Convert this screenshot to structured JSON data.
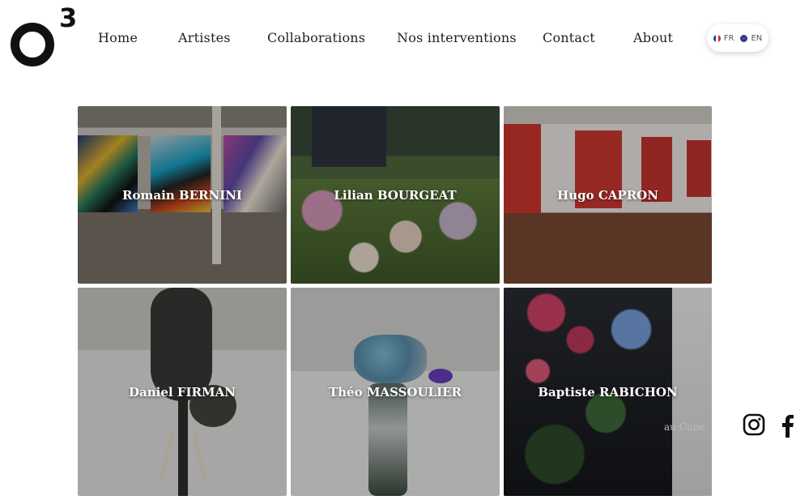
{
  "logo": {
    "letter": "O",
    "superscript": "3"
  },
  "nav": {
    "items": [
      {
        "label": "Home"
      },
      {
        "label": "Artistes"
      },
      {
        "label": "Collaborations"
      },
      {
        "label": "Nos interventions"
      },
      {
        "label": "Contact"
      },
      {
        "label": "About"
      }
    ]
  },
  "language": {
    "fr": "FR",
    "en": "EN"
  },
  "artists": [
    {
      "name": "Romain BERNINI"
    },
    {
      "name": "Lilian BOURGEAT"
    },
    {
      "name": "Hugo CAPRON"
    },
    {
      "name": "Daniel FIRMAN"
    },
    {
      "name": "Théo MASSOULIER"
    },
    {
      "name": "Baptiste RABICHON"
    }
  ],
  "background_text": "au Cube",
  "social": {
    "instagram": "instagram-icon",
    "facebook": "facebook-icon"
  }
}
